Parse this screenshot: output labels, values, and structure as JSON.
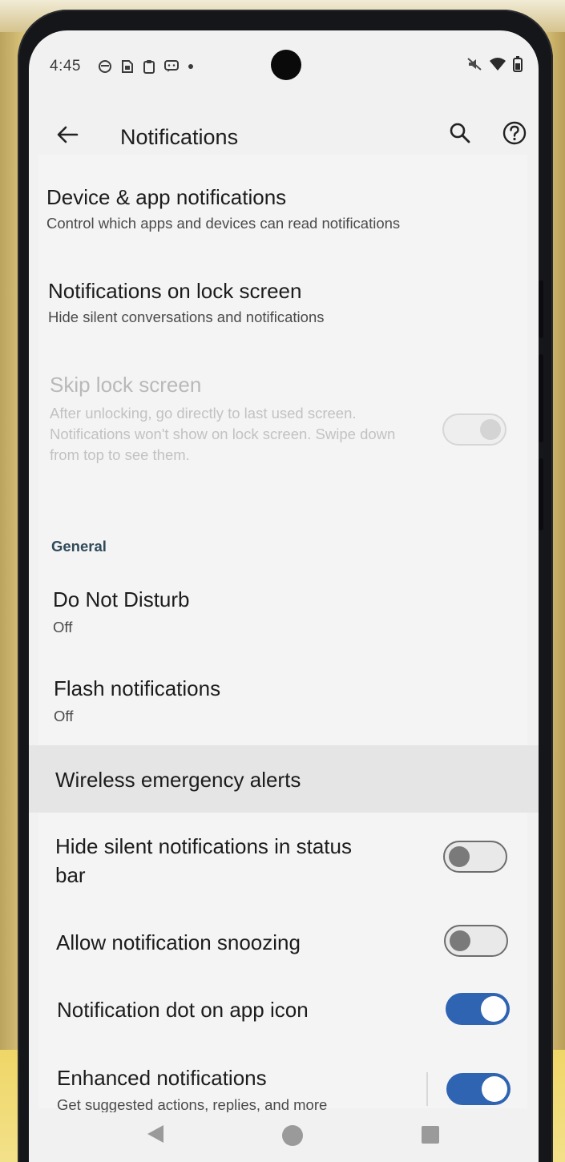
{
  "status_bar": {
    "time": "4:45",
    "left_icons": [
      "data-saver-icon",
      "sim-icon",
      "clipboard-icon",
      "message-icon",
      "dot-icon"
    ],
    "right_icons": [
      "mute-icon",
      "wifi-icon",
      "battery-icon"
    ]
  },
  "app_bar": {
    "title": "Notifications",
    "back_icon": "arrow-left-icon",
    "search_icon": "search-icon",
    "help_icon": "help-icon"
  },
  "items": {
    "device_app": {
      "title": "Device & app notifications",
      "subtitle": "Control which apps and devices can read notifications"
    },
    "lock_screen": {
      "title": "Notifications on lock screen",
      "subtitle": "Hide silent conversations and notifications"
    },
    "skip_lock": {
      "title": "Skip lock screen",
      "subtitle": "After unlocking, go directly to last used screen. Notifications won't show on lock screen. Swipe down from top to see them.",
      "enabled": false,
      "checked": true
    },
    "general_header": "General",
    "dnd": {
      "title": "Do Not Disturb",
      "subtitle": "Off"
    },
    "flash": {
      "title": "Flash notifications",
      "subtitle": "Off"
    },
    "wea": {
      "title": "Wireless emergency alerts"
    },
    "hide_silent": {
      "title_line1": "Hide silent notifications in status",
      "title_line2": "bar",
      "checked": false
    },
    "snooze": {
      "title": "Allow notification snoozing",
      "checked": false
    },
    "dot": {
      "title": "Notification dot on app icon",
      "checked": true
    },
    "enhanced": {
      "title": "Enhanced notifications",
      "subtitle": "Get suggested actions, replies, and more",
      "checked": true
    }
  },
  "nav_bar": {
    "back_icon": "nav-back-icon",
    "home_icon": "nav-home-icon",
    "recents_icon": "nav-recents-icon"
  },
  "colors": {
    "accent": "#2f64b3",
    "background": "#f4f4f4",
    "section_header": "#2f4a5a"
  }
}
